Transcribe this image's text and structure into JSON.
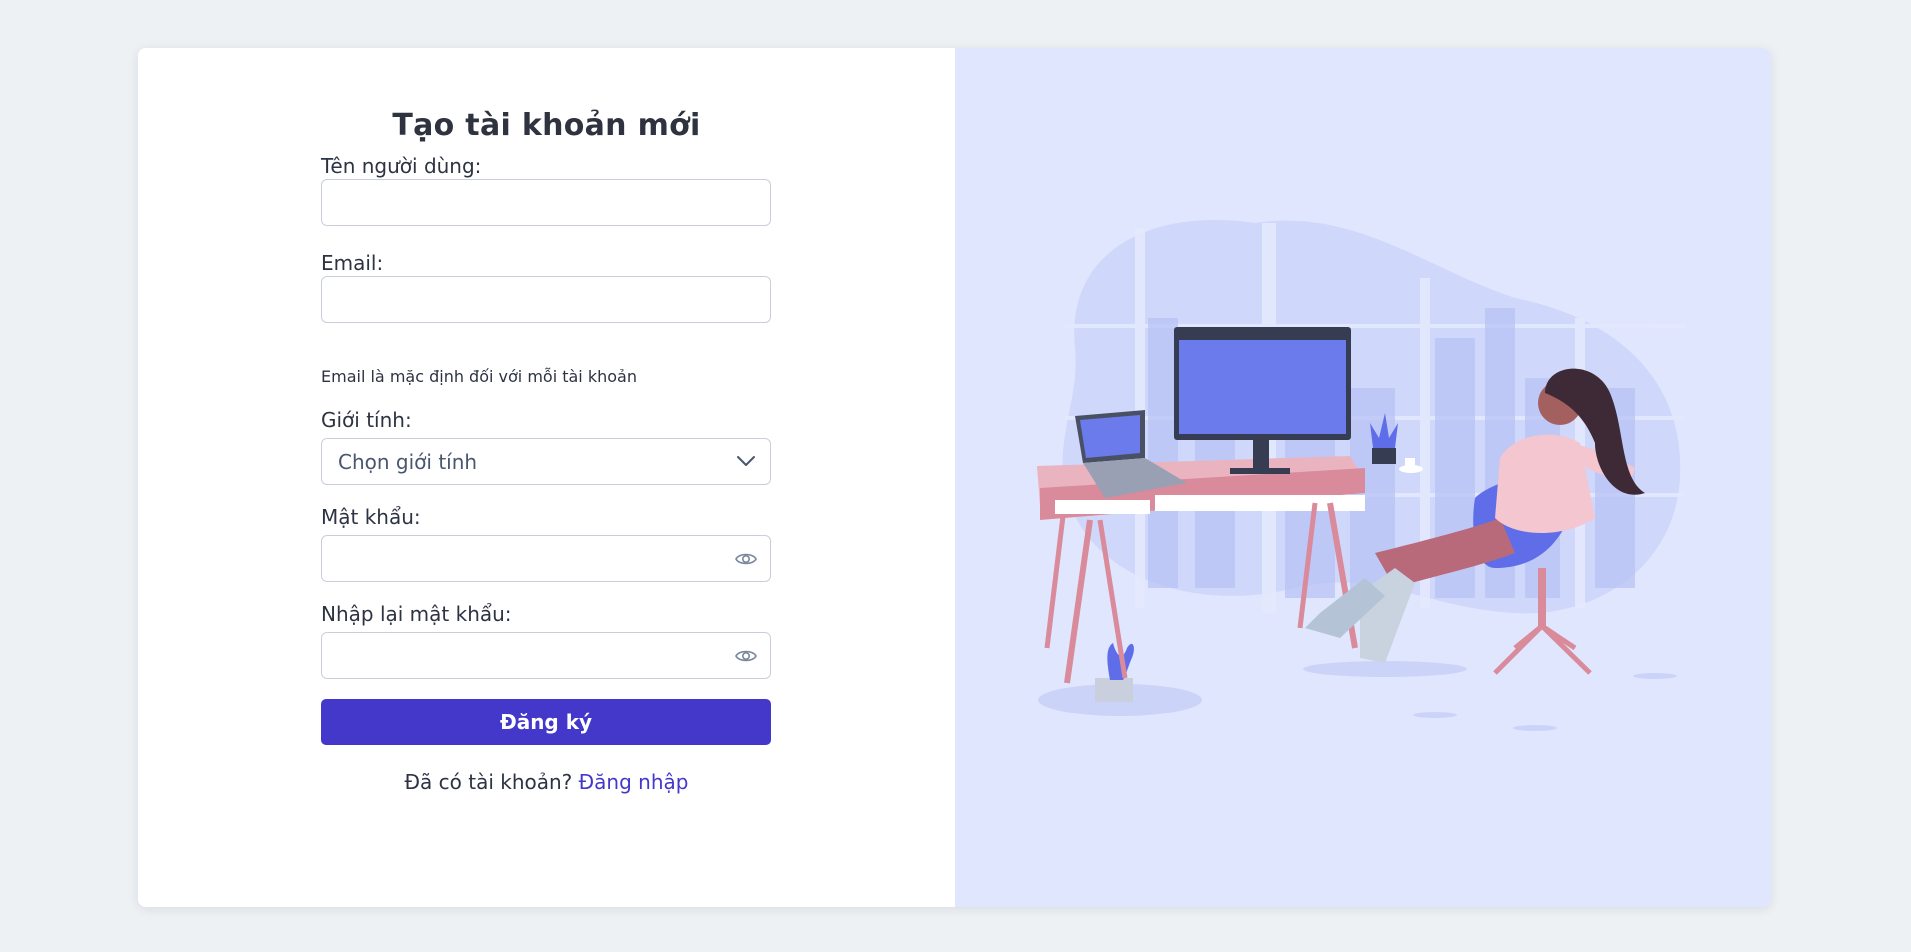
{
  "form": {
    "title": "Tạo tài khoản mới",
    "username": {
      "label": "Tên người dùng:",
      "value": "",
      "placeholder": ""
    },
    "email": {
      "label": "Email:",
      "value": "",
      "placeholder": "",
      "hint": "Email là mặc định đối với mỗi tài khoản"
    },
    "gender": {
      "label": "Giới tính:",
      "selected": "Chọn giới tính"
    },
    "password": {
      "label": "Mật khẩu:",
      "value": ""
    },
    "confirm_password": {
      "label": "Nhập lại mật khẩu:",
      "value": ""
    },
    "submit_label": "Đăng ký",
    "login_prompt": "Đã có tài khoản?",
    "login_link": "Đăng nhập"
  },
  "icons": {
    "select": "chevron-down-icon",
    "password_toggle": "eye-icon"
  },
  "colors": {
    "primary": "#4338ca",
    "page_background": "#edf1f4",
    "illustration_background": "#e0e6fd",
    "field_border": "#c9cfd9"
  }
}
